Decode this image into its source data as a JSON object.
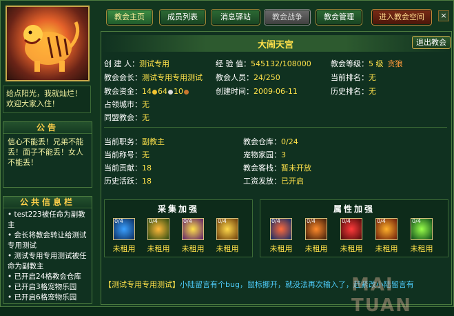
{
  "tabs": [
    {
      "label": "教会主页"
    },
    {
      "label": "成员列表"
    },
    {
      "label": "消息驿站"
    },
    {
      "label": "教会战争"
    },
    {
      "label": "教会管理"
    },
    {
      "label": "进入教会空间"
    }
  ],
  "close_glyph": "×",
  "left": {
    "motto": "给点阳光，我就灿烂！欢迎大家入住！",
    "notice_title": "公告",
    "notice_text": "信心不能丢！兄弟不能丢！面子不能丢！女人不能丢！",
    "info_title": "公共信息栏",
    "info_items": [
      "test223被任命为副教主",
      "会长将教会转让给测试专用测试",
      "测试专用专用测试被任命为副教主",
      "已开启24格教会仓库",
      "已开启3格宠物乐园",
      "已开启6格宠物乐园"
    ]
  },
  "guild": {
    "name": "大闹天宫",
    "quit_label": "退出教会",
    "creator_label": "创 建 人：",
    "creator": "测试专用",
    "exp_label": "经 验 值：",
    "exp": "545132/108000",
    "level_label": "教会等级：",
    "level": "5 级",
    "level_tag": "贪狼",
    "leader_label": "教会会长：",
    "leader": "测试专用专用测试",
    "members_label": "教会人员：",
    "members": "24/250",
    "rank_label": "当前排名：",
    "rank": "无",
    "funds_label": "教会资金：",
    "funds_gold": "14",
    "funds_silver": "64",
    "funds_copper": "10",
    "created_label": "创建时间：",
    "created": "2009-06-11",
    "history_rank_label": "历史排名：",
    "history_rank": "无",
    "city_label": "占领城市：",
    "city": "无",
    "alliance_label": "同盟教会：",
    "alliance": "无"
  },
  "personal": {
    "job_label": "当前职务：",
    "job": "副教主",
    "title_label": "当前称号：",
    "title": "无",
    "contrib_label": "当前贡献：",
    "contrib": "18",
    "activity_label": "历史活跃：",
    "activity": "18",
    "warehouse_label": "教会仓库：",
    "warehouse": "0/24",
    "pet_label": "宠物家园：",
    "pet": "3",
    "inn_label": "教会客栈：",
    "inn": "暂未开放",
    "wage_label": "工资发放：",
    "wage": "已开启"
  },
  "gather": {
    "title": "采集加强",
    "slots": [
      {
        "count": "0/4",
        "label": "未租用",
        "icon": "blue-slash-icon"
      },
      {
        "count": "0/4",
        "label": "未租用",
        "icon": "green-leaf-icon"
      },
      {
        "count": "0/4",
        "label": "未租用",
        "icon": "purple-cross-icon"
      },
      {
        "count": "0/4",
        "label": "未租用",
        "icon": "golden-swirl-icon"
      }
    ]
  },
  "attr": {
    "title": "属性加强",
    "slots": [
      {
        "count": "0/4",
        "label": "未租用",
        "icon": "blue-orb-icon"
      },
      {
        "count": "0/4",
        "label": "未租用",
        "icon": "fire-warrior-icon"
      },
      {
        "count": "0/4",
        "label": "未租用",
        "icon": "red-helmet-icon"
      },
      {
        "count": "0/4",
        "label": "未租用",
        "icon": "orange-flame-icon"
      },
      {
        "count": "0/4",
        "label": "未租用",
        "icon": "green-burst-icon"
      }
    ]
  },
  "chat": {
    "name": "【测试专用专用测试】",
    "msg": "小陆留言有个bug，鼠标挪开，就没法再次输入了，赶紧改小陆留言有"
  },
  "watermark": "MAI TUAN"
}
